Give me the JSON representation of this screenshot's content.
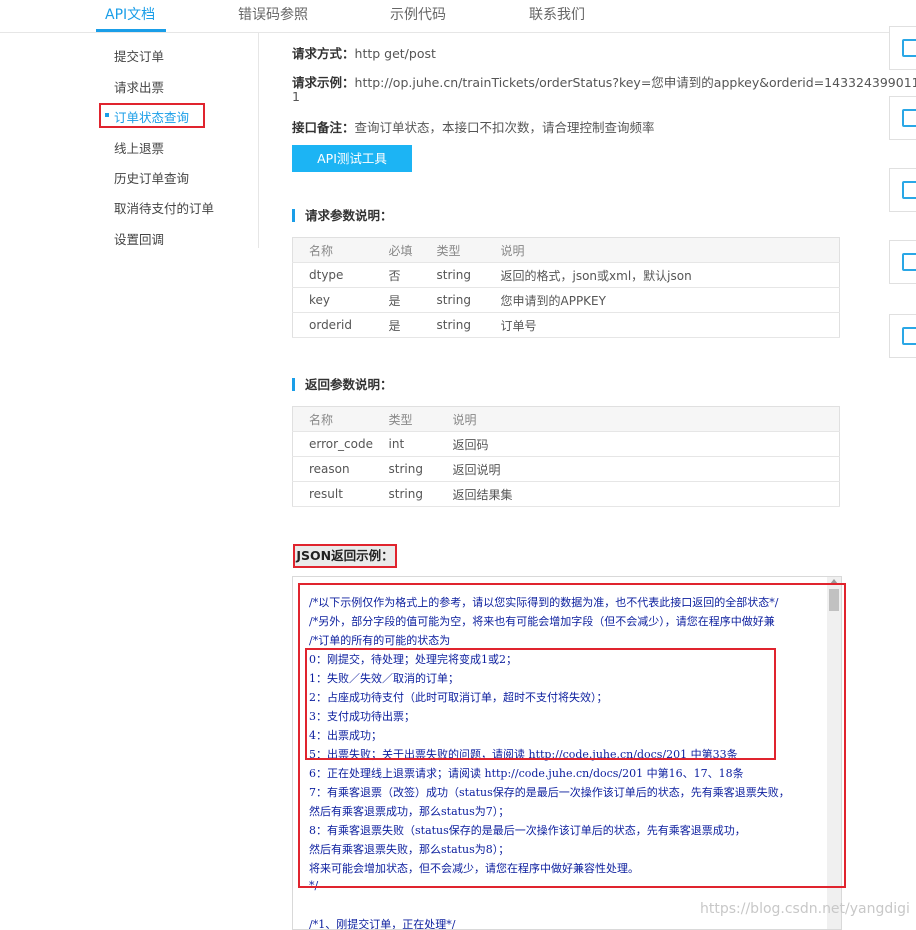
{
  "topnav": {
    "tabs": [
      "API文档",
      "错误码参照",
      "示例代码",
      "联系我们"
    ]
  },
  "sidebar": {
    "items": [
      "提交订单",
      "请求出票",
      "订单状态查询",
      "线上退票",
      "历史订单查询",
      "取消待支付的订单",
      "设置回调"
    ]
  },
  "info": {
    "method_label": "请求方式：",
    "method_value": "http get/post",
    "example_label": "请求示例：",
    "example_value_1": "http://op.juhe.cn/trainTickets/orderStatus?key=您申请到的appkey&orderid=143324399011",
    "example_value_2": "1",
    "note_label": "接口备注：",
    "note_value": "查询订单状态，本接口不扣次数，请合理控制查询频率",
    "button": "API测试工具"
  },
  "request_params": {
    "title": "请求参数说明：",
    "headers": [
      "名称",
      "必填",
      "类型",
      "说明"
    ],
    "rows": [
      [
        "dtype",
        "否",
        "string",
        "返回的格式，json或xml，默认json"
      ],
      [
        "key",
        "是",
        "string",
        "您申请到的APPKEY"
      ],
      [
        "orderid",
        "是",
        "string",
        "订单号"
      ]
    ]
  },
  "return_params": {
    "title": "返回参数说明：",
    "headers": [
      "名称",
      "类型",
      "说明"
    ],
    "rows": [
      [
        "error_code",
        "int",
        "返回码"
      ],
      [
        "reason",
        "string",
        "返回说明"
      ],
      [
        "result",
        "string",
        "返回结果集"
      ]
    ]
  },
  "json_example": {
    "title": "JSON返回示例：",
    "lines": [
      "/*以下示例仅作为格式上的参考，请以您实际得到的数据为准，也不代表此接口返回的全部状态*/",
      "/*另外，部分字段的值可能为空，将来也有可能会增加字段（但不会减少），请您在程序中做好兼",
      "/*订单的所有的可能的状态为",
      "0：刚提交，待处理；处理完将变成1或2；",
      "1：失败／失效／取消的订单；",
      "2：占座成功待支付（此时可取消订单，超时不支付将失效）；",
      "3：支付成功待出票；",
      "4：出票成功；",
      "5：出票失败；关于出票失败的问题，请阅读 http://code.juhe.cn/docs/201 中第33条",
      "6：正在处理线上退票请求；请阅读 http://code.juhe.cn/docs/201 中第16、17、18条",
      "7：有乘客退票（改签）成功（status保存的是最后一次操作该订单后的状态，先有乘客退票失败，",
      "然后有乘客退票成功，那么status为7）；",
      "8：有乘客退票失败（status保存的是最后一次操作该订单后的状态，先有乘客退票成功，",
      "然后有乘客退票失败，那么status为8）；",
      "将来可能会增加状态，但不会减少，请您在程序中做好兼容性处理。",
      "*/",
      "",
      "/*1、刚提交订单，正在处理*/"
    ]
  },
  "watermark": "https://blog.csdn.net/yangdigi",
  "colors": {
    "accent": "#1a9ee8",
    "highlight": "#e0242e",
    "code": "#0b1e9e"
  }
}
